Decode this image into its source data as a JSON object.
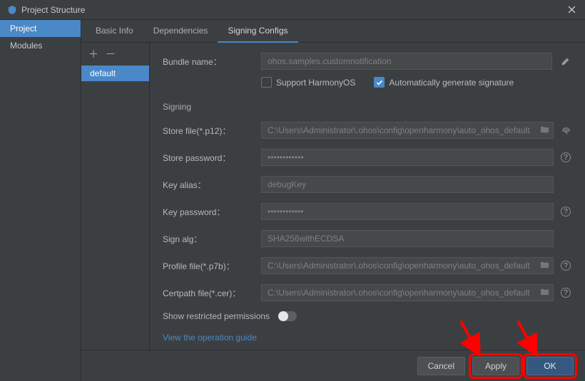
{
  "window": {
    "title": "Project Structure"
  },
  "sidebar": {
    "items": [
      {
        "label": "Project",
        "selected": true
      },
      {
        "label": "Modules",
        "selected": false
      }
    ]
  },
  "tabs": [
    {
      "label": "Basic Info",
      "active": false
    },
    {
      "label": "Dependencies",
      "active": false
    },
    {
      "label": "Signing Configs",
      "active": true
    }
  ],
  "configs": {
    "addLabel": "＋",
    "removeLabel": "－",
    "items": [
      {
        "name": "default",
        "selected": true
      }
    ]
  },
  "form": {
    "bundleName": {
      "label": "Bundle name：",
      "value": "ohos.samples.customnotification"
    },
    "supportHarmony": {
      "label": "Support HarmonyOS",
      "checked": false
    },
    "autoSign": {
      "label": "Automatically generate signature",
      "checked": true
    },
    "signingHeader": "Signing",
    "storeFile": {
      "label": "Store file(*.p12)：",
      "value": "C:\\Users\\Administrator\\.ohos\\config\\openharmony\\auto_ohos_default"
    },
    "storePassword": {
      "label": "Store password：",
      "value": "••••••••••••"
    },
    "keyAlias": {
      "label": "Key alias：",
      "value": "debugKey"
    },
    "keyPassword": {
      "label": "Key password：",
      "value": "••••••••••••"
    },
    "signAlg": {
      "label": "Sign alg：",
      "value": "SHA256withECDSA"
    },
    "profileFile": {
      "label": "Profile file(*.p7b)：",
      "value": "C:\\Users\\Administrator\\.ohos\\config\\openharmony\\auto_ohos_default"
    },
    "certpathFile": {
      "label": "Certpath file(*.cer)：",
      "value": "C:\\Users\\Administrator\\.ohos\\config\\openharmony\\auto_ohos_default"
    },
    "restrictedPerms": {
      "label": "Show restricted permissions",
      "checked": false
    },
    "guideLink": "View the operation guide"
  },
  "footer": {
    "cancel": "Cancel",
    "apply": "Apply",
    "ok": "OK"
  }
}
